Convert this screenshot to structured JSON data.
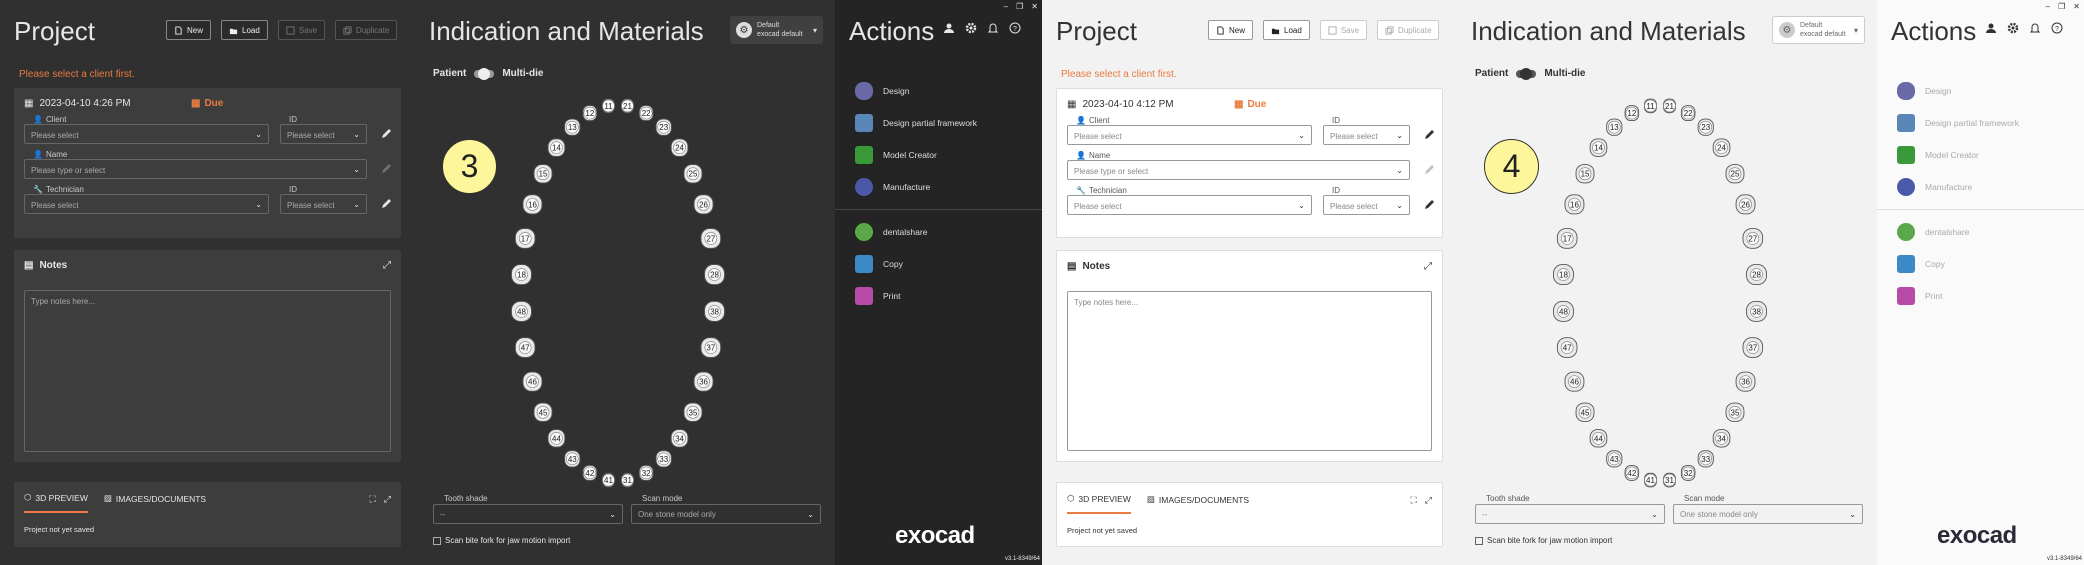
{
  "panels": [
    {
      "project": {
        "title": "Project",
        "buttons": {
          "new": "New",
          "load": "Load",
          "save": "Save",
          "duplicate": "Duplicate"
        },
        "warning": "Please select a client first.",
        "datetime": "2023-04-10 4:26 PM",
        "due": "Due",
        "fields": {
          "client_label": "Client",
          "client_placeholder": "Please select",
          "client_id_label": "ID",
          "client_id_placeholder": "Please select",
          "name_label": "Name",
          "name_placeholder": "Please type or select",
          "technician_label": "Technician",
          "technician_placeholder": "Please select",
          "technician_id_label": "ID",
          "technician_id_placeholder": "Please select"
        },
        "notes": {
          "title": "Notes",
          "placeholder": "Type notes here..."
        },
        "preview": {
          "tab_3d": "3D PREVIEW",
          "tab_images": "IMAGES/DOCUMENTS",
          "status": "Project not yet saved"
        }
      },
      "indication": {
        "title": "Indication and Materials",
        "toggle": {
          "left": "Patient",
          "right": "Multi-die"
        },
        "default_btn": {
          "line1": "Default",
          "line2": "exocad default"
        },
        "badge": "3",
        "tooth_shade_label": "Tooth shade",
        "tooth_shade_value": "--",
        "scan_mode_label": "Scan mode",
        "scan_mode_value": "One stone model only",
        "bite_fork": "Scan bite fork for jaw motion import"
      },
      "actions": {
        "title": "Actions",
        "items": [
          "Design",
          "Design partial framework",
          "Model Creator",
          "Manufacture"
        ],
        "items2": [
          "dentalshare",
          "Copy",
          "Print"
        ],
        "logo": "exocad",
        "version": "v3.1-8349/64"
      }
    },
    {
      "project": {
        "title": "Project",
        "buttons": {
          "new": "New",
          "load": "Load",
          "save": "Save",
          "duplicate": "Duplicate"
        },
        "warning": "Please select a client first.",
        "datetime": "2023-04-10 4:12 PM",
        "due": "Due",
        "fields": {
          "client_label": "Client",
          "client_placeholder": "Please select",
          "client_id_label": "ID",
          "client_id_placeholder": "Please select",
          "name_label": "Name",
          "name_placeholder": "Please type or select",
          "technician_label": "Technician",
          "technician_placeholder": "Please select",
          "technician_id_label": "ID",
          "technician_id_placeholder": "Please select"
        },
        "notes": {
          "title": "Notes",
          "placeholder": "Type notes here..."
        },
        "preview": {
          "tab_3d": "3D PREVIEW",
          "tab_images": "IMAGES/DOCUMENTS",
          "status": "Project not yet saved"
        }
      },
      "indication": {
        "title": "Indication and Materials",
        "toggle": {
          "left": "Patient",
          "right": "Multi-die"
        },
        "default_btn": {
          "line1": "Default",
          "line2": "exocad default"
        },
        "badge": "4",
        "tooth_shade_label": "Tooth shade",
        "tooth_shade_value": "--",
        "scan_mode_label": "Scan mode",
        "scan_mode_value": "One stone model only",
        "bite_fork": "Scan bite fork for jaw motion import"
      },
      "actions": {
        "title": "Actions",
        "items": [
          "Design",
          "Design partial framework",
          "Model Creator",
          "Manufacture"
        ],
        "items2": [
          "dentalshare",
          "Copy",
          "Print"
        ],
        "logo": "exocad",
        "version": "v3.1-8349/64"
      }
    }
  ],
  "teeth": {
    "upper": [
      "18",
      "17",
      "16",
      "15",
      "14",
      "13",
      "12",
      "11",
      "21",
      "22",
      "23",
      "24",
      "25",
      "26",
      "27",
      "28"
    ],
    "lower": [
      "48",
      "47",
      "46",
      "45",
      "44",
      "43",
      "42",
      "41",
      "31",
      "32",
      "33",
      "34",
      "35",
      "36",
      "37",
      "38"
    ]
  },
  "colors": {
    "accent": "#e97b40",
    "badge": "#fdf69a",
    "dark_bg": "#303030",
    "light_bg": "#f2f2f2"
  },
  "icons": {
    "design": "tooth-icon",
    "partial": "clasp-icon",
    "model": "model-creator-icon",
    "manufacture": "manufacture-icon",
    "dentalshare": "dentalshare-icon",
    "copy": "copy-icon",
    "print": "print-icon"
  }
}
